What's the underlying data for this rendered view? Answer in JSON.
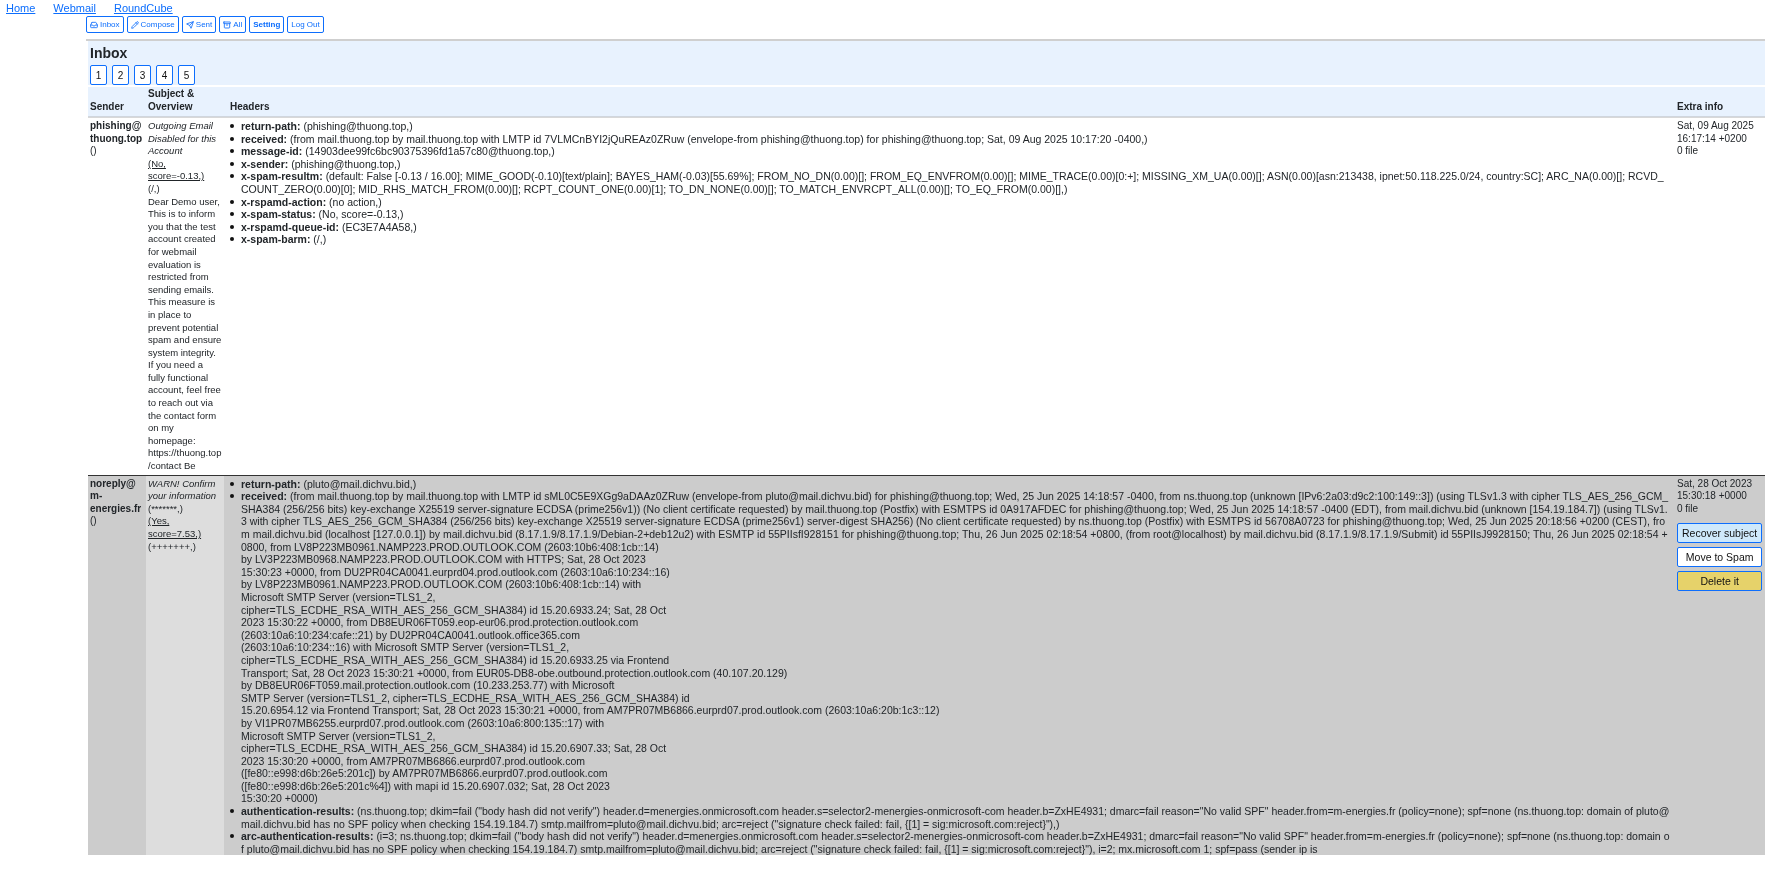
{
  "nav": {
    "links": [
      "Home",
      "Webmail",
      "RoundCube"
    ],
    "buttons": [
      {
        "label": "Inbox",
        "emphasized": false
      },
      {
        "label": "Compose",
        "emphasized": false
      },
      {
        "label": "Sent",
        "emphasized": false
      },
      {
        "label": "All",
        "emphasized": false
      },
      {
        "label": "Setting",
        "emphasized": true
      },
      {
        "label": "Log Out",
        "emphasized": false
      }
    ]
  },
  "page": {
    "title": "Inbox",
    "pages": [
      "1",
      "2",
      "3",
      "4",
      "5"
    ]
  },
  "table": {
    "columns": [
      "Sender",
      "Subject & Overview",
      "Headers",
      "Extra info"
    ],
    "rows": [
      {
        "highlighted": false,
        "sender": {
          "address": "phishing@thuong.top",
          "name": "()"
        },
        "subject": {
          "title": "Outgoing Email Disabled for this Account",
          "spam_link": "(No, score=-0.13,)",
          "marks": "(/,)",
          "overview": "Dear Demo user, This is to inform you that the test account created for webmail evaluation is restricted from sending emails. This measure is in place to prevent potential spam and ensure system integrity. If you need a fully functional account, feel free to reach out via the contact form on my homepage: https://thuong.top/contact Be"
        },
        "headers": [
          {
            "name": "return-path:",
            "value": "(phishing@thuong.top,)"
          },
          {
            "name": "received:",
            "value": "(from mail.thuong.top by mail.thuong.top with LMTP id 7VLMCnBYI2jQuREAz0ZRuw (envelope-from phishing@thuong.top) for phishing@thuong.top; Sat, 09 Aug 2025 10:17:20 -0400,)"
          },
          {
            "name": "message-id:",
            "value": "(14903dee99fc6bc90375396fd1a57c80@thuong.top,)"
          },
          {
            "name": "x-sender:",
            "value": "(phishing@thuong.top,)"
          },
          {
            "name": "x-spam-resultm:",
            "value": "(default: False [-0.13 / 16.00]; MIME_GOOD(-0.10)[text/plain]; BAYES_HAM(-0.03)[55.69%]; FROM_NO_DN(0.00)[]; FROM_EQ_ENVFROM(0.00)[]; MIME_TRACE(0.00)[0:+]; MISSING_XM_UA(0.00)[]; ASN(0.00)[asn:213438, ipnet:50.118.225.0/24, country:SC]; ARC_NA(0.00)[]; RCVD_COUNT_ZERO(0.00)[0]; MID_RHS_MATCH_FROM(0.00)[]; RCPT_COUNT_ONE(0.00)[1]; TO_DN_NONE(0.00)[]; TO_MATCH_ENVRCPT_ALL(0.00)[]; TO_EQ_FROM(0.00)[],)"
          },
          {
            "name": "x-rspamd-action:",
            "value": "(no action,)"
          },
          {
            "name": "x-spam-status:",
            "value": "(No, score=-0.13,)"
          },
          {
            "name": "x-rspamd-queue-id:",
            "value": "(EC3E7A4A58,)"
          },
          {
            "name": "x-spam-barm:",
            "value": "(/,)"
          }
        ],
        "extra": {
          "date": "Sat, 09 Aug 2025 16:17:14 +0200",
          "files": "0 file"
        }
      },
      {
        "highlighted": true,
        "sender": {
          "address": "noreply@m-energies.fr",
          "name": "()"
        },
        "subject": {
          "title": "WARN! Confirm your information",
          "prefix": "(*******,)",
          "spam_link": "(Yes, score=7.53,)",
          "marks": "(+++++++,)"
        },
        "headers": [
          {
            "name": "return-path:",
            "value": "(pluto@mail.dichvu.bid,)"
          },
          {
            "name": "received:",
            "value": "(from mail.thuong.top by mail.thuong.top with LMTP id sML0C5E9XGg9aDAAz0ZRuw (envelope-from pluto@mail.dichvu.bid) for phishing@thuong.top; Wed, 25 Jun 2025 14:18:57 -0400, from ns.thuong.top (unknown [IPv6:2a03:d9c2:100:149::3]) (using TLSv1.3 with cipher TLS_AES_256_GCM_SHA384 (256/256 bits) key-exchange X25519 server-signature ECDSA (prime256v1)) (No client certificate requested) by mail.thuong.top (Postfix) with ESMTPS id 0A917AFDEC for phishing@thuong.top; Wed, 25 Jun 2025 14:18:57 -0400 (EDT), from mail.dichvu.bid (unknown [154.19.184.7]) (using TLSv1.3 with cipher TLS_AES_256_GCM_SHA384 (256/256 bits) key-exchange X25519 server-signature ECDSA (prime256v1) server-digest SHA256) (No client certificate requested) by ns.thuong.top (Postfix) with ESMTPS id 56708A0723 for phishing@thuong.top; Wed, 25 Jun 2025 20:18:56 +0200 (CEST), from mail.dichvu.bid (localhost [127.0.0.1]) by mail.dichvu.bid (8.17.1.9/8.17.1.9/Debian-2+deb12u2) with ESMTP id 55PIIsfI928151 for phishing@thuong.top; Thu, 26 Jun 2025 02:18:54 +0800, (from root@localhost) by mail.dichvu.bid (8.17.1.9/8.17.1.9/Submit) id 55PIIsJ9928150; Thu, 26 Jun 2025 02:18:54 +0800, from LV8P223MB0961.NAMP223.PROD.OUTLOOK.COM (2603:10b6:408:1cb::14)\nby LV3P223MB0968.NAMP223.PROD.OUTLOOK.COM with HTTPS; Sat, 28 Oct 2023\n15:30:23 +0000, from DU2PR04CA0041.eurprd04.prod.outlook.com (2603:10a6:10:234::16)\nby LV8P223MB0961.NAMP223.PROD.OUTLOOK.COM (2603:10b6:408:1cb::14) with\nMicrosoft SMTP Server (version=TLS1_2,\ncipher=TLS_ECDHE_RSA_WITH_AES_256_GCM_SHA384) id 15.20.6933.24; Sat, 28 Oct\n2023 15:30:22 +0000, from DB8EUR06FT059.eop-eur06.prod.protection.outlook.com\n(2603:10a6:10:234:cafe::21) by DU2PR04CA0041.outlook.office365.com\n(2603:10a6:10:234::16) with Microsoft SMTP Server (version=TLS1_2,\ncipher=TLS_ECDHE_RSA_WITH_AES_256_GCM_SHA384) id 15.20.6933.25 via Frontend\nTransport; Sat, 28 Oct 2023 15:30:21 +0000, from EUR05-DB8-obe.outbound.protection.outlook.com (40.107.20.129)\nby DB8EUR06FT059.mail.protection.outlook.com (10.233.253.77) with Microsoft\nSMTP Server (version=TLS1_2, cipher=TLS_ECDHE_RSA_WITH_AES_256_GCM_SHA384) id\n15.20.6954.12 via Frontend Transport; Sat, 28 Oct 2023 15:30:21 +0000, from AM7PR07MB6866.eurprd07.prod.outlook.com (2603:10a6:20b:1c3::12)\nby VI1PR07MB6255.eurprd07.prod.outlook.com (2603:10a6:800:135::17) with\nMicrosoft SMTP Server (version=TLS1_2,\ncipher=TLS_ECDHE_RSA_WITH_AES_256_GCM_SHA384) id 15.20.6907.33; Sat, 28 Oct\n2023 15:30:20 +0000, from AM7PR07MB6866.eurprd07.prod.outlook.com\n([fe80::e998:d6b:26e5:201c]) by AM7PR07MB6866.eurprd07.prod.outlook.com\n([fe80::e998:d6b:26e5:201c%4]) with mapi id 15.20.6907.032; Sat, 28 Oct 2023\n15:30:20 +0000)"
          },
          {
            "name": "authentication-results:",
            "value": "(ns.thuong.top; dkim=fail (\"body hash did not verify\") header.d=menergies.onmicrosoft.com header.s=selector2-menergies-onmicrosoft-com header.b=ZxHE4931; dmarc=fail reason=\"No valid SPF\" header.from=m-energies.fr (policy=none); spf=none (ns.thuong.top: domain of pluto@mail.dichvu.bid has no SPF policy when checking 154.19.184.7) smtp.mailfrom=pluto@mail.dichvu.bid; arc=reject (\"signature check failed: fail, {[1] = sig:microsoft.com:reject}\"),)"
          },
          {
            "name": "arc-authentication-results:",
            "value": "(i=3; ns.thuong.top; dkim=fail (\"body hash did not verify\") header.d=menergies.onmicrosoft.com header.s=selector2-menergies-onmicrosoft-com header.b=ZxHE4931; dmarc=fail reason=\"No valid SPF\" header.from=m-energies.fr (policy=none); spf=none (ns.thuong.top: domain of pluto@mail.dichvu.bid has no SPF policy when checking 154.19.184.7) smtp.mailfrom=pluto@mail.dichvu.bid; arc=reject (\"signature check failed: fail, {[1] = sig:microsoft.com:reject}\"), i=2; mx.microsoft.com 1; spf=pass (sender ip is"
          }
        ],
        "extra": {
          "date": "Sat, 28 Oct 2023 15:30:18 +0000",
          "files": "0 file",
          "actions": [
            {
              "label": "Recover subject",
              "kind": "info"
            },
            {
              "label": "Move to Spam",
              "kind": "plain"
            },
            {
              "label": "Delete it",
              "kind": "warning"
            }
          ]
        }
      }
    ]
  }
}
